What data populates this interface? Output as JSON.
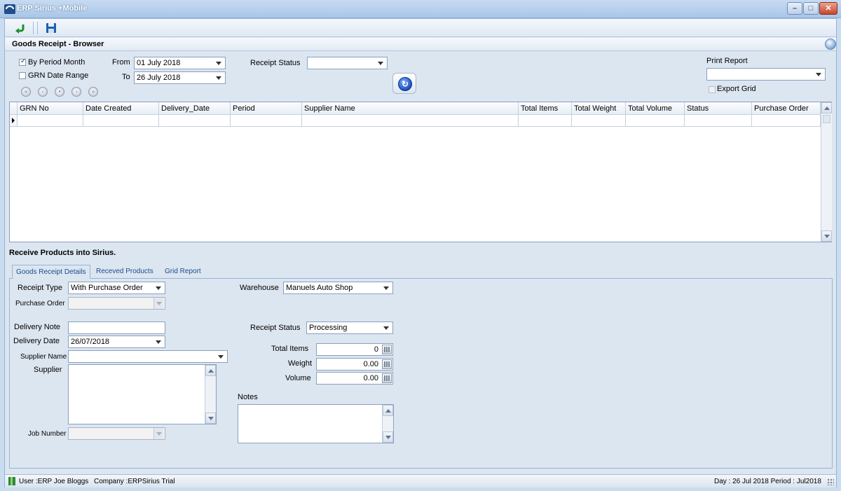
{
  "window": {
    "title": "ERP Sirius +Mobile",
    "controls": {
      "minimize": "–",
      "maximize": "□",
      "close": "✕"
    }
  },
  "toolbar": {
    "back_icon": "green-return-arrow-icon",
    "save_icon": "floppy-disk-icon"
  },
  "browser": {
    "title": "Goods Receipt - Browser",
    "by_period_month": {
      "label": "By Period Month",
      "checked": true,
      "mark": "✓"
    },
    "grn_date_range": {
      "label": "GRN Date Range",
      "checked": false
    },
    "from_label": "From",
    "from_value": "01 July 2018",
    "to_label": "To",
    "to_value": "26 July 2018",
    "receipt_status_label": "Receipt Status",
    "receipt_status_value": "",
    "print_report_label": "Print Report",
    "print_report_value": "",
    "export_grid_label": "Export Grid",
    "nav_glyphs": [
      "«",
      "‹",
      "•",
      "›",
      "»"
    ],
    "refresh_glyph": "↻"
  },
  "grid": {
    "columns": [
      "GRN No",
      "Date Created",
      "Delivery_Date",
      "Period",
      "Supplier Name",
      "Total Items",
      "Total Weight",
      "Total Volume",
      "Status",
      "Purchase Order"
    ]
  },
  "receive": {
    "title": "Receive Products into Sirius.",
    "tabs": [
      "Goods Receipt Details",
      "Receved Products",
      "Grid Report"
    ],
    "fields": {
      "receipt_type_label": "Receipt Type",
      "receipt_type_value": "With Purchase Order",
      "purchase_order_label": "Purchase Order",
      "purchase_order_value": "",
      "delivery_note_label": "Delivery Note",
      "delivery_note_value": "",
      "delivery_date_label": "Delivery Date",
      "delivery_date_value": "26/07/2018",
      "supplier_name_label": "Supplier Name",
      "supplier_name_value": "",
      "supplier_label": "Supplier",
      "job_number_label": "Job Number",
      "job_number_value": "",
      "warehouse_label": "Warehouse",
      "warehouse_value": "Manuels Auto Shop",
      "receipt_status_label": "Receipt Status",
      "receipt_status_value": "Processing",
      "total_items_label": "Total Items",
      "total_items_value": "0",
      "weight_label": "Weight",
      "weight_value": "0.00",
      "volume_label": "Volume",
      "volume_value": "0.00",
      "notes_label": "Notes"
    }
  },
  "statusbar": {
    "user": "User :ERP Joe Bloggs",
    "company": "Company :ERPSirius Trial",
    "day_period": "Day : 26 Jul 2018  Period : Jul2018"
  }
}
